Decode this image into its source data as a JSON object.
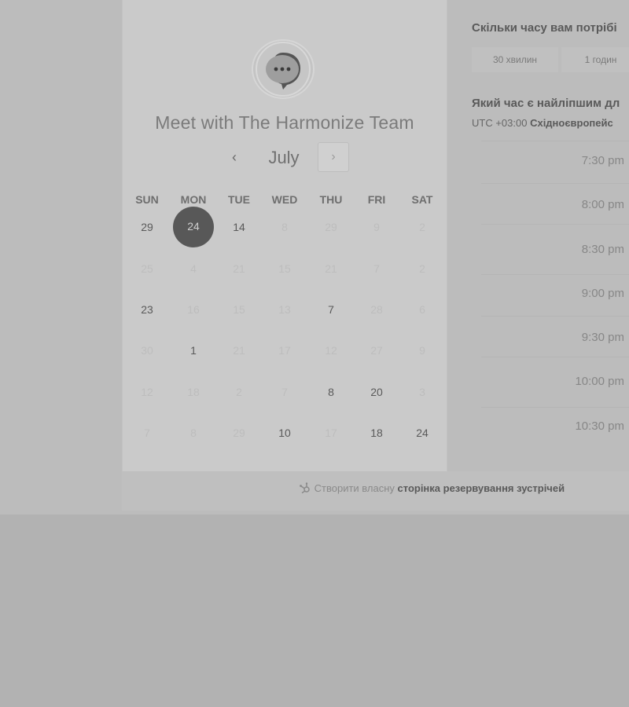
{
  "calendar": {
    "title": "Meet with The Harmonize Team",
    "month": "July",
    "prev_glyph": "‹",
    "next_glyph": "›",
    "weekdays": [
      "SUN",
      "MON",
      "TUE",
      "WED",
      "THU",
      "FRI",
      "SAT"
    ],
    "weeks": [
      [
        {
          "d": "29",
          "on": true
        },
        {
          "d": "24",
          "on": true,
          "selected": true
        },
        {
          "d": "14",
          "on": true
        },
        {
          "d": "8",
          "on": false
        },
        {
          "d": "29",
          "on": false
        },
        {
          "d": "9",
          "on": false
        },
        {
          "d": "2",
          "on": false
        }
      ],
      [
        {
          "d": "25",
          "on": false
        },
        {
          "d": "4",
          "on": false
        },
        {
          "d": "21",
          "on": false
        },
        {
          "d": "15",
          "on": false
        },
        {
          "d": "21",
          "on": false
        },
        {
          "d": "7",
          "on": false
        },
        {
          "d": "2",
          "on": false
        }
      ],
      [
        {
          "d": "23",
          "on": true
        },
        {
          "d": "16",
          "on": false
        },
        {
          "d": "15",
          "on": false
        },
        {
          "d": "13",
          "on": false
        },
        {
          "d": "7",
          "on": true
        },
        {
          "d": "28",
          "on": false
        },
        {
          "d": "6",
          "on": false
        }
      ],
      [
        {
          "d": "30",
          "on": false
        },
        {
          "d": "1",
          "on": true
        },
        {
          "d": "21",
          "on": false
        },
        {
          "d": "17",
          "on": false
        },
        {
          "d": "12",
          "on": false
        },
        {
          "d": "27",
          "on": false
        },
        {
          "d": "9",
          "on": false
        }
      ],
      [
        {
          "d": "12",
          "on": false
        },
        {
          "d": "18",
          "on": false
        },
        {
          "d": "2",
          "on": false
        },
        {
          "d": "7",
          "on": false
        },
        {
          "d": "8",
          "on": true
        },
        {
          "d": "20",
          "on": true
        },
        {
          "d": "3",
          "on": false
        }
      ],
      [
        {
          "d": "7",
          "on": false
        },
        {
          "d": "8",
          "on": false
        },
        {
          "d": "29",
          "on": false
        },
        {
          "d": "10",
          "on": true
        },
        {
          "d": "17",
          "on": false
        },
        {
          "d": "18",
          "on": true
        },
        {
          "d": "24",
          "on": true
        }
      ]
    ]
  },
  "duration": {
    "question": "Скільки часу вам потрібі",
    "options": [
      "30 хвилин",
      "1 годин"
    ]
  },
  "time": {
    "question": "Який час є найліпшим дл",
    "timezone_prefix": "UTC +03:00",
    "timezone_name": "Східноєвропейс",
    "slots": [
      "7:30 pm",
      "8:00 pm",
      "8:30 pm",
      "9:00 pm",
      "9:30 pm",
      "10:00 pm",
      "10:30 pm"
    ]
  },
  "footer": {
    "prefix": "Створити власну",
    "link": "сторінка резервування зустрічей"
  },
  "colors": {
    "background": "#b2b2b2",
    "card": "#cacaca",
    "selected_day": "#585858"
  }
}
